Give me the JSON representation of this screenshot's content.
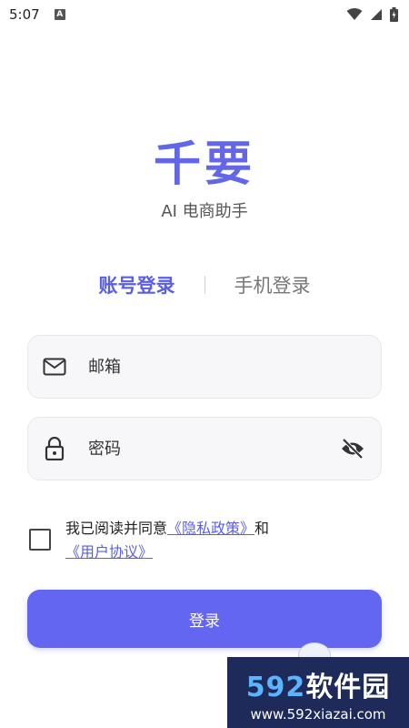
{
  "status_bar": {
    "time": "5:07",
    "badge": "A"
  },
  "app": {
    "title": "千要",
    "subtitle": "AI 电商助手"
  },
  "tabs": [
    {
      "label": "账号登录",
      "active": true
    },
    {
      "label": "手机登录",
      "active": false
    }
  ],
  "form": {
    "email_placeholder": "邮箱",
    "password_placeholder": "密码"
  },
  "agreement": {
    "prefix": "我已阅读并同意",
    "privacy_link": "《隐私政策》",
    "conjunction": "和",
    "terms_link": "《用户协议》",
    "checked": false
  },
  "login_button": "登录",
  "watermark": {
    "logo_number": "592",
    "logo_text": "软件园",
    "url": "www.592xiazai.com"
  },
  "colors": {
    "accent": "#6366f1",
    "title": "#6366e6"
  }
}
